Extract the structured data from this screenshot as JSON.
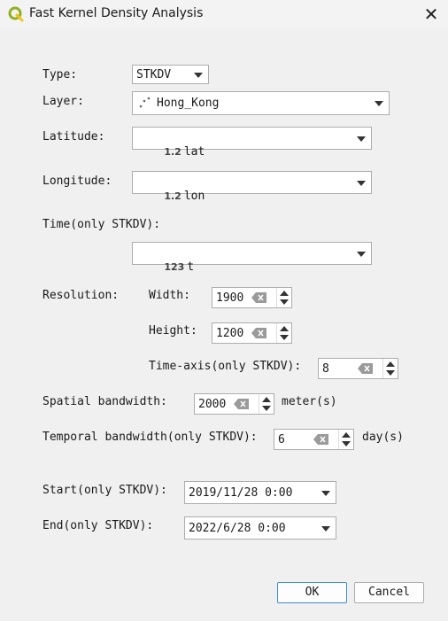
{
  "window": {
    "title": "Fast Kernel Density Analysis",
    "close_glyph": "✕"
  },
  "colors": {
    "accent": "#0078d4",
    "qgis_green": "#93b023",
    "qgis_yellow": "#f0c419"
  },
  "form": {
    "type_label": "Type:",
    "type_value": "STKDV",
    "layer_label": "Layer:",
    "layer_icon": "point-layer-icon",
    "layer_value": "Hong_Kong",
    "latitude_label": "Latitude:",
    "latitude_badge": "1.2",
    "latitude_value": "lat",
    "longitude_label": "Longitude:",
    "longitude_badge": "1.2",
    "longitude_value": "lon",
    "time_label": "Time(only STKDV):",
    "time_badge": "123",
    "time_value": "t",
    "resolution_label": "Resolution:",
    "width_label": "Width:",
    "width_value": "1900",
    "height_label": "Height:",
    "height_value": "1200",
    "time_axis_label": "Time-axis(only STKDV):",
    "time_axis_value": "8",
    "spatial_bw_label": "Spatial bandwidth:",
    "spatial_bw_value": "2000",
    "spatial_bw_unit": "meter(s)",
    "temporal_bw_label": "Temporal bandwidth(only STKDV):",
    "temporal_bw_value": "6",
    "temporal_bw_unit": "day(s)",
    "start_label": "Start(only STKDV):",
    "start_value": "2019/11/28 0:00",
    "end_label": "End(only STKDV):",
    "end_value": "2022/6/28 0:00"
  },
  "buttons": {
    "ok": "OK",
    "cancel": "Cancel"
  }
}
